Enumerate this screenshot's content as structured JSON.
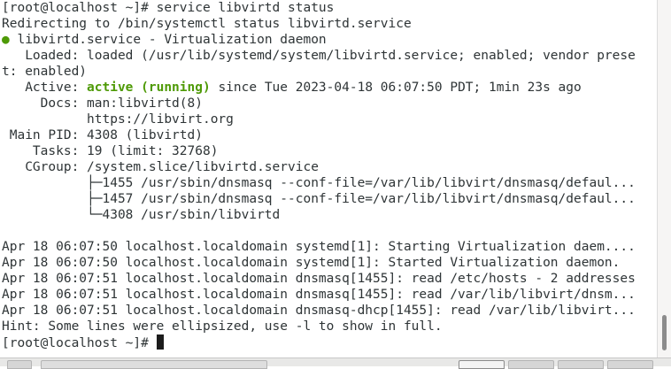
{
  "terminal": {
    "lines": [
      "[root@localhost ~]# service libvirtd status",
      "Redirecting to /bin/systemctl status libvirtd.service",
      "",
      "   Loaded: loaded (/usr/lib/systemd/system/libvirtd.service; enabled; vendor prese",
      "t: enabled)",
      "",
      "     Docs: man:libvirtd(8)",
      "           https://libvirt.org",
      " Main PID: 4308 (libvirtd)",
      "    Tasks: 19 (limit: 32768)",
      "   CGroup: /system.slice/libvirtd.service",
      "           ├─1455 /usr/sbin/dnsmasq --conf-file=/var/lib/libvirt/dnsmasq/defaul...",
      "           ├─1457 /usr/sbin/dnsmasq --conf-file=/var/lib/libvirt/dnsmasq/defaul...",
      "           └─4308 /usr/sbin/libvirtd",
      "",
      "Apr 18 06:07:50 localhost.localdomain systemd[1]: Starting Virtualization daem....",
      "Apr 18 06:07:50 localhost.localdomain systemd[1]: Started Virtualization daemon.",
      "Apr 18 06:07:51 localhost.localdomain dnsmasq[1455]: read /etc/hosts - 2 addresses",
      "Apr 18 06:07:51 localhost.localdomain dnsmasq[1455]: read /var/lib/libvirt/dnsm...",
      "Apr 18 06:07:51 localhost.localdomain dnsmasq-dhcp[1455]: read /var/lib/libvirt...",
      "Hint: Some lines were ellipsized, use -l to show in full.",
      ""
    ],
    "service_line": {
      "dot": "●",
      "text": " libvirtd.service - Virtualization daemon"
    },
    "active_line": {
      "prefix": "   Active: ",
      "status": "active (running)",
      "suffix": " since Tue 2023-04-18 06:07:50 PDT; 1min 23s ago"
    },
    "prompt": "[root@localhost ~]# ",
    "colors": {
      "text": "#2e3436",
      "active_green": "#4e9a06",
      "background": "#ffffff"
    }
  }
}
